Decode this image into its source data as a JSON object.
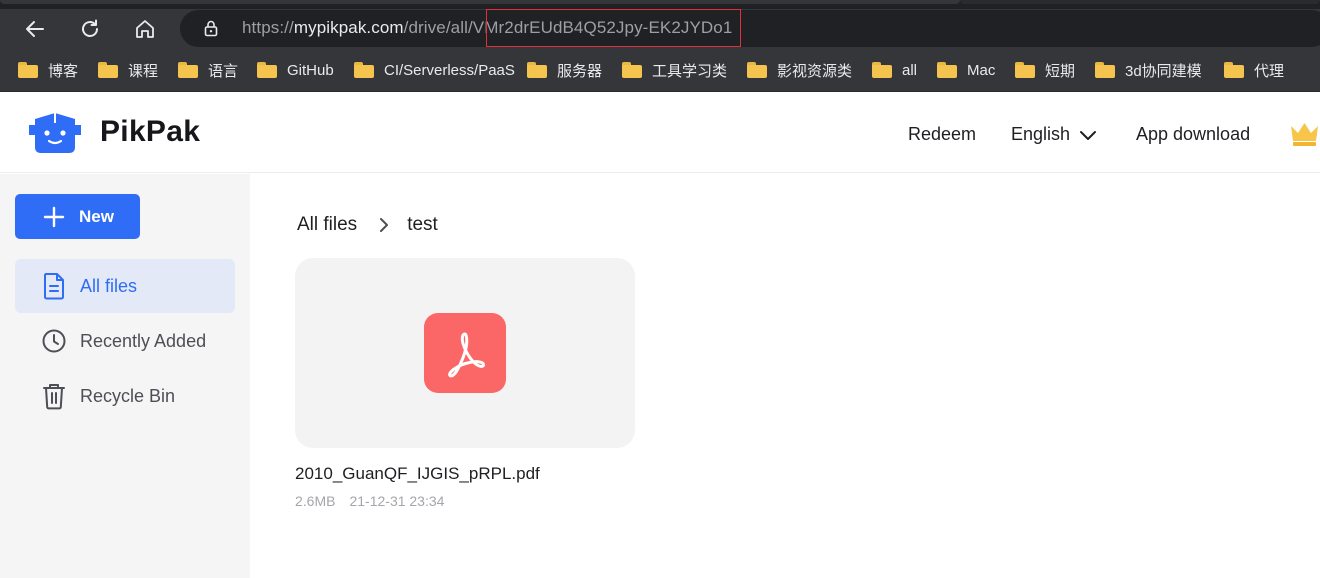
{
  "browser": {
    "url": {
      "scheme": "https://",
      "host": "mypikpak.com",
      "path": "/drive/all/",
      "folder_id": "VMr2drEUdB4Q52Jpy-EK2JYDo1"
    },
    "bookmarks": [
      {
        "label": "博客"
      },
      {
        "label": "课程"
      },
      {
        "label": "语言"
      },
      {
        "label": "GitHub"
      },
      {
        "label": "CI/Serverless/PaaS"
      },
      {
        "label": "服务器"
      },
      {
        "label": "工具学习类"
      },
      {
        "label": "影视资源类"
      },
      {
        "label": "all"
      },
      {
        "label": "Mac"
      },
      {
        "label": "短期"
      },
      {
        "label": "3d协同建模"
      },
      {
        "label": "代理"
      }
    ]
  },
  "header": {
    "brand": "PikPak",
    "redeem": "Redeem",
    "language": "English",
    "app_download": "App download"
  },
  "sidebar": {
    "new_button": "New",
    "items": [
      {
        "label": "All files",
        "icon": "document-icon",
        "active": true
      },
      {
        "label": "Recently Added",
        "icon": "clock-icon",
        "active": false
      },
      {
        "label": "Recycle Bin",
        "icon": "trash-icon",
        "active": false
      }
    ]
  },
  "main": {
    "breadcrumb": [
      "All files",
      "test"
    ],
    "files": [
      {
        "name": "2010_GuanQF_IJGIS_pRPL.pdf",
        "size": "2.6MB",
        "date": "21-12-31 23:34",
        "type_icon": "pdf-icon"
      }
    ]
  },
  "colors": {
    "accent": "#2f6df6",
    "pdf": "#fb6767",
    "highlight_border": "#e0303a",
    "crown": "#f7c548"
  }
}
